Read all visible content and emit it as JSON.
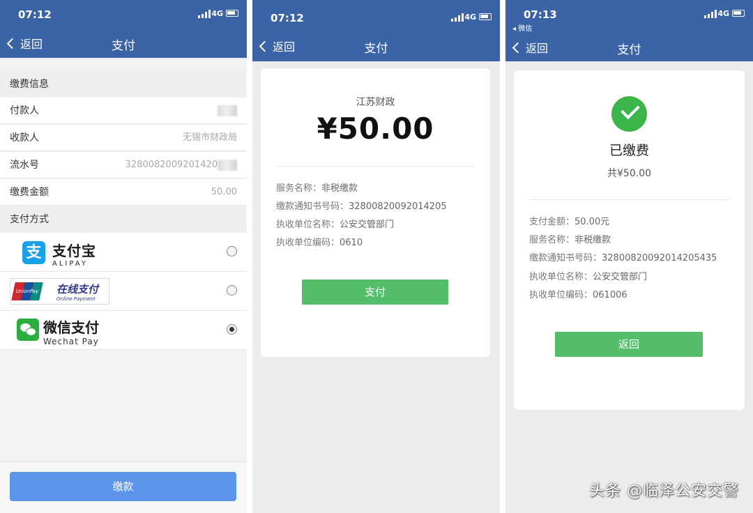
{
  "screens": [
    {
      "status": {
        "time": "07:12",
        "network": "4G"
      },
      "nav": {
        "back": "返回",
        "title": "支付"
      },
      "section_info": "缴费信息",
      "rows": [
        {
          "label": "付款人",
          "value": ""
        },
        {
          "label": "收款人",
          "value": "无锡市财政局"
        },
        {
          "label": "流水号",
          "value": "3280082009201420"
        },
        {
          "label": "缴费金额",
          "value": "50.00"
        }
      ],
      "section_method": "支付方式",
      "methods": {
        "alipay": {
          "cn": "支付宝",
          "en": "ALIPAY",
          "selected": false
        },
        "unionpay": {
          "badge": "UnionPay 银联",
          "cn": "在线支付",
          "en": "Online Payment",
          "selected": false
        },
        "wechat": {
          "cn": "微信支付",
          "en": "Wechat Pay",
          "selected": true
        }
      },
      "submit": "缴款"
    },
    {
      "status": {
        "time": "07:12",
        "network": "4G"
      },
      "nav": {
        "back": "返回",
        "title": "支付"
      },
      "merchant": "江苏财政",
      "amount": "¥50.00",
      "details": [
        {
          "label": "服务名称：",
          "value": "非税缴款"
        },
        {
          "label": "缴款通知书号码：",
          "value": "3280082009201420​5"
        },
        {
          "label": "执收单位名称：",
          "value": "公安交管部门"
        },
        {
          "label": "执收单位编码：",
          "value": "0610"
        }
      ],
      "pay_button": "支付"
    },
    {
      "status": {
        "time": "07:13",
        "network": "4G",
        "source_app": "◂ 微信"
      },
      "nav": {
        "back": "返回",
        "title": "支付"
      },
      "result": "已缴费",
      "total": "共¥50.00",
      "details": [
        {
          "label": "支付金额：",
          "value": "50.00元"
        },
        {
          "label": "服务名称：",
          "value": "非税缴款"
        },
        {
          "label": "缴款通知书号码：",
          "value": "32800820092014205435"
        },
        {
          "label": "执收单位名称：",
          "value": "公安交管部门"
        },
        {
          "label": "执收单位编码：",
          "value": "061006"
        }
      ],
      "back_button": "返回"
    }
  ],
  "watermark": "头条 @临泽公安交警",
  "colors": {
    "header": "#3b64a6",
    "primary_blue": "#5c94e9",
    "green": "#53bd6a",
    "success": "#3bb54a"
  }
}
